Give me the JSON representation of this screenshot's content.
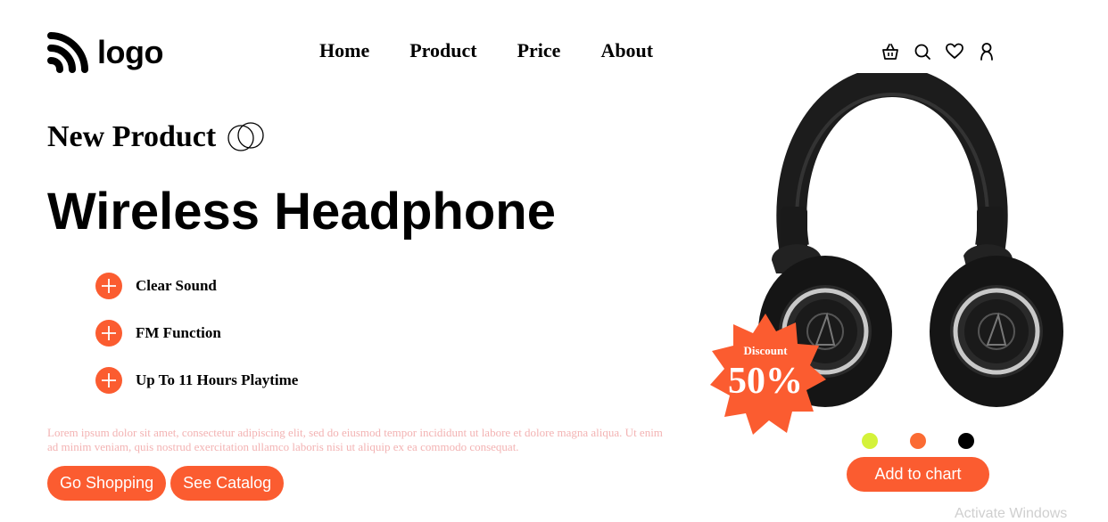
{
  "header": {
    "logo_text": "logo",
    "nav": [
      "Home",
      "Product",
      "Price",
      "About"
    ],
    "icons": [
      "basket-icon",
      "search-icon",
      "heart-icon",
      "user-icon"
    ]
  },
  "hero": {
    "eyebrow": "New Product",
    "headline": "Wireless Headphone",
    "features": [
      "Clear Sound",
      "FM Function",
      "Up To 11 Hours Playtime"
    ],
    "description": "Lorem ipsum dolor sit amet, consectetur adipiscing elit, sed do eiusmod tempor incididunt ut labore et dolore magna aliqua. Ut enim ad minim veniam, quis nostrud exercitation ullamco laboris nisi ut aliquip ex ea commodo consequat.",
    "buttons": [
      "Go Shopping",
      "See Catalog"
    ]
  },
  "product": {
    "badge_label": "Discount",
    "badge_value": "50%",
    "color_options": [
      "#d4f23a",
      "#fb6b33",
      "#000000"
    ],
    "cart_button": "Add to chart"
  },
  "watermark": "Activate Windows",
  "colors": {
    "accent": "#fb5c30",
    "text": "#000000",
    "muted": "#f3b3b3"
  }
}
